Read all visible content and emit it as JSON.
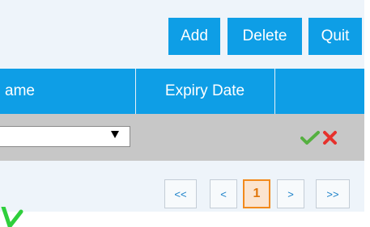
{
  "toolbar": {
    "add_label": "Add",
    "delete_label": "Delete",
    "quit_label": "Quit"
  },
  "table": {
    "columns": [
      "ame",
      "Expiry Date",
      ""
    ]
  },
  "pager": {
    "first": "<<",
    "prev": "<",
    "current": "1",
    "next": ">",
    "last": ">>"
  },
  "colors": {
    "accent": "#0e9ee6",
    "row_bg": "#c7c7c7",
    "panel_bg": "#eef4fa",
    "check_green": "#55b040",
    "delete_red": "#e6312c",
    "page_active": "#f28a1c"
  },
  "icons": {
    "save": "check-icon",
    "remove": "x-icon",
    "dropdown": "dropdown-arrow-icon"
  }
}
